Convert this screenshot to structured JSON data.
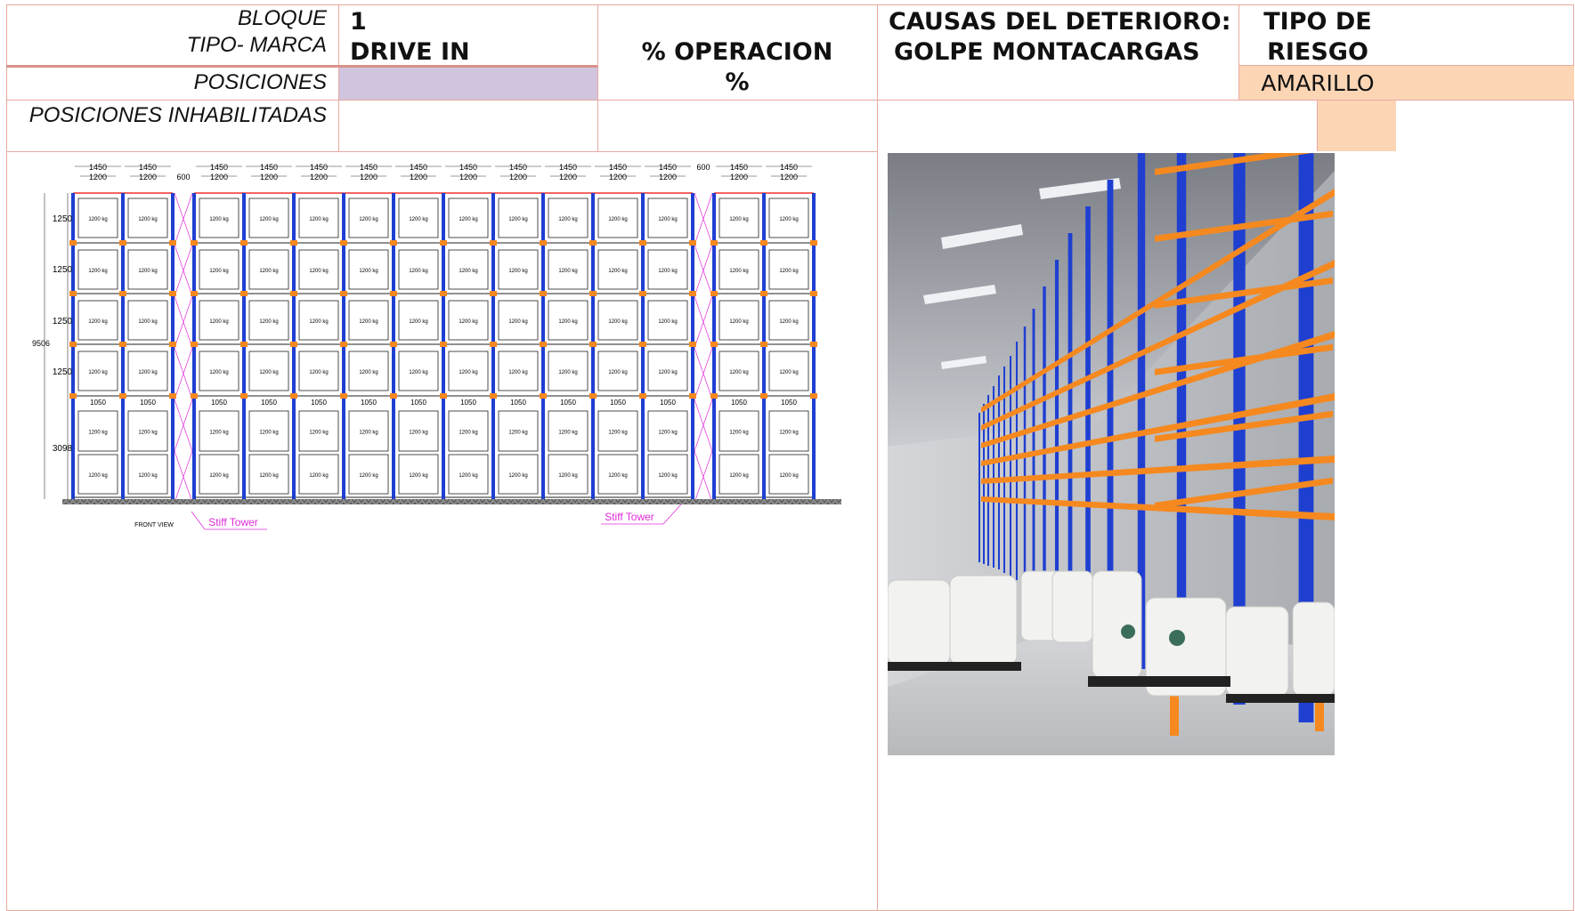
{
  "header": {
    "bloque_label": "BLOQUE",
    "bloque_value": "1",
    "tipo_marca_label": "TIPO- MARCA",
    "tipo_marca_value": "DRIVE IN",
    "posiciones_label": "POSICIONES",
    "posiciones_inhabilitadas_label": "POSICIONES INHABILITADAS",
    "operacion_label": "% OPERACION",
    "operacion_value": "%",
    "causas_label": "CAUSAS DEL DETERIORO:",
    "causas_value": "GOLPE MONTACARGAS",
    "tipo_riesgo_label_1": "TIPO DE",
    "tipo_riesgo_label_2": "RIESGO",
    "tipo_riesgo_value": "AMARILLO"
  },
  "colors": {
    "border": "#e8a9a0",
    "posiciones_fill": "#d1c4df",
    "riesgo_fill": "#fcd5b5",
    "rack_blue": "#1f3fd1",
    "rack_orange": "#f5891f",
    "annotation_magenta": "#e02bd8"
  },
  "drawing": {
    "bay_widths_outer": [
      "1450",
      "1450",
      "1450",
      "1450",
      "1450",
      "1450",
      "1450",
      "1450",
      "1450",
      "1450",
      "1450",
      "1450",
      "1450",
      "1450"
    ],
    "bay_widths_inner": [
      "1200",
      "1200",
      "1200",
      "1200",
      "1200",
      "1200",
      "1200",
      "1200",
      "1200",
      "1200",
      "1200",
      "1200",
      "1200",
      "1200"
    ],
    "gap_width": "600",
    "level_heights": [
      "1250",
      "1250",
      "1250",
      "1250",
      "3098"
    ],
    "total_height": "9506",
    "beam_width": "1050",
    "load_label": "1200 kg",
    "front_view_label": "FRONT VIEW",
    "stiff_tower_label": "Stiff Tower"
  },
  "photo": {
    "description_icon": "warehouse-racking-photo"
  }
}
